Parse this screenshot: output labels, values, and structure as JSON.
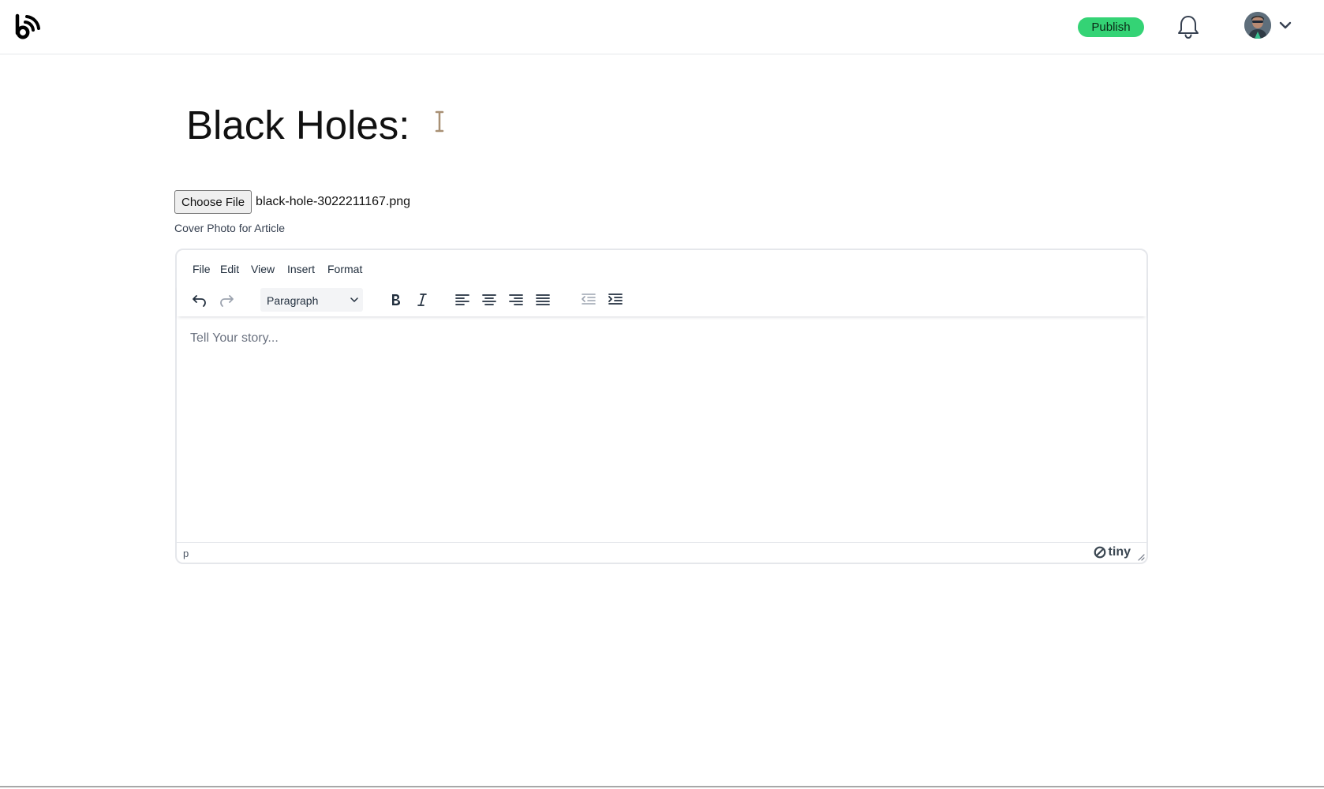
{
  "header": {
    "logo_icon": "blog-broadcast-logo-icon",
    "publish_label": "Publish",
    "notifications_icon": "bell-icon",
    "profile_icon": "avatar",
    "menu_icon": "chevron-down-icon",
    "accent_color": "#34d375"
  },
  "article": {
    "title": "Black Holes:"
  },
  "cover": {
    "button_label": "Choose File",
    "file_name": "black-hole-3022211167.png",
    "caption": "Cover Photo for Article"
  },
  "editor": {
    "menu": [
      "File",
      "Edit",
      "View",
      "Insert",
      "Format"
    ],
    "toolbar": {
      "block_format": "Paragraph",
      "buttons": [
        "undo-icon",
        "redo-icon",
        "bold-icon",
        "italic-icon",
        "align-left-icon",
        "align-center-icon",
        "align-right-icon",
        "align-justify-icon",
        "outdent-icon",
        "indent-icon"
      ]
    },
    "placeholder": "Tell Your story...",
    "path": "p",
    "branding": "tiny"
  }
}
